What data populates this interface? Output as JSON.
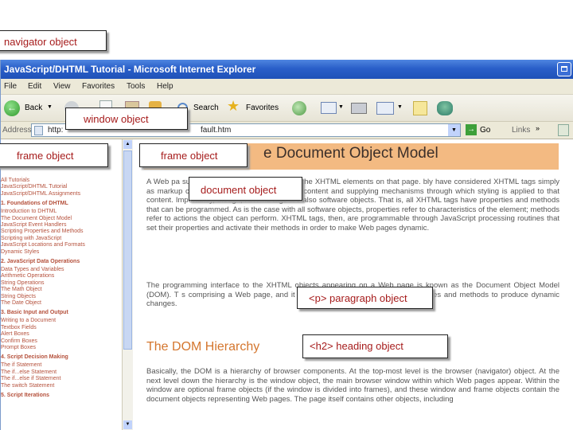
{
  "window": {
    "title": "JavaScript/DHTML Tutorial - Microsoft Internet Explorer"
  },
  "menu": [
    "File",
    "Edit",
    "View",
    "Favorites",
    "Tools",
    "Help"
  ],
  "toolbar": {
    "back": "Back",
    "search": "Search",
    "favorites": "Favorites"
  },
  "address": {
    "label": "Address",
    "url_start": "http:",
    "url_end": "fault.htm",
    "go": "Go",
    "links": "Links"
  },
  "callouts": {
    "navigator": "navigator object",
    "window": "window object",
    "frame_left": "frame object",
    "frame_main": "frame object",
    "document": "document object",
    "paragraph": "<p> paragraph object",
    "heading": "<h2> heading object"
  },
  "nav": [
    {
      "text": "All Tutorials",
      "head": false
    },
    {
      "text": "JavaScript/DHTML Tutorial",
      "head": false
    },
    {
      "text": "JavaScript/DHTML Assignments",
      "head": false
    },
    {
      "text": "1. Foundations of DHTML",
      "head": true
    },
    {
      "text": "Introduction to DHTML",
      "head": false
    },
    {
      "text": "The Document Object Model",
      "head": false
    },
    {
      "text": "JavaScript Event Handlers",
      "head": false
    },
    {
      "text": "Scripting Properties and Methods",
      "head": false
    },
    {
      "text": "Scripting with JavaScript",
      "head": false
    },
    {
      "text": "JavaScript Locations and Formats",
      "head": false
    },
    {
      "text": "Dynamic Styles",
      "head": false
    },
    {
      "text": "2. JavaScript Data Operations",
      "head": true
    },
    {
      "text": "Data Types and Variables",
      "head": false
    },
    {
      "text": "Arithmetic Operations",
      "head": false
    },
    {
      "text": "String Operations",
      "head": false
    },
    {
      "text": "The Math Object",
      "head": false
    },
    {
      "text": "String Objects",
      "head": false
    },
    {
      "text": "The Date Object",
      "head": false
    },
    {
      "text": "3. Basic Input and Output",
      "head": true
    },
    {
      "text": "Writing to a Document",
      "head": false
    },
    {
      "text": "Textbox Fields",
      "head": false
    },
    {
      "text": "Alert Boxes",
      "head": false
    },
    {
      "text": "Confirm Boxes",
      "head": false
    },
    {
      "text": "Prompt Boxes",
      "head": false
    },
    {
      "text": "4. Script Decision Making",
      "head": true
    },
    {
      "text": "The if Statement",
      "head": false
    },
    {
      "text": "The if...else Statement",
      "head": false
    },
    {
      "text": "The if...else if Statement",
      "head": false
    },
    {
      "text": "The switch Statement",
      "head": false
    },
    {
      "text": "5. Script Iterations",
      "head": true
    }
  ],
  "page": {
    "h1": "e Document Object Model",
    "p1": "A Web pa                                supplying JavaScript processing to the XHTML elements on that page.                              bly have considered XHTML tags simply as markup codes providing structure to page content and supplying mechanisms through which styling is applied to that content. Importantly, though, XHTML tags are also software objects. That is, all XHTML tags have properties and methods that can be programmed. As is the case with all software objects, properties refer to characteristics of the element; methods refer to actions the object can perform. XHTML tags, then, are programmable through JavaScript processing routines that set their properties and activate their methods in order to make Web pages dynamic.",
    "p2": "The programming interface to the XHTML objects appearing on a Web page is known as the Document Object Model (DOM). T                                                        s comprising a Web page, and it provides the means for ident                                                   ir properties and methods to produce dynamic changes.",
    "h2": "The DOM Hierarchy",
    "p3": "Basically, the DOM is a hierarchy of browser components. At the top-most level is the browser (navigator) object. At the next level down the hierarchy is the window object, the main browser window within which Web pages appear. Within the window are optional frame objects (if the window is divided into frames), and these window and frame objects contain the document objects representing Web pages. The page itself contains other objects, including"
  }
}
